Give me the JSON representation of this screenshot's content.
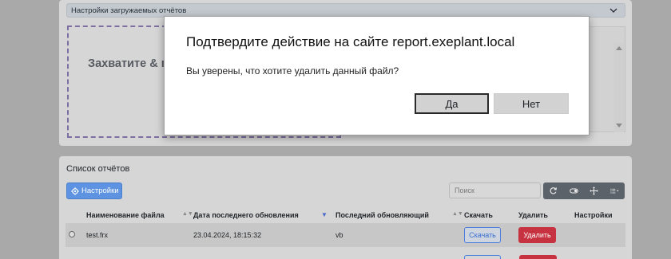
{
  "upload_settings": {
    "accordion_label": "Настройки загружаемых отчётов",
    "dropzone_text": "Захватите & п"
  },
  "reports": {
    "title": "Список отчётов",
    "settings_button": "Настройки",
    "search_placeholder": "Поиск",
    "columns": {
      "name": "Наименование файла",
      "date": "Дата последнего обновления",
      "user": "Последний обновляющий",
      "download": "Скачать",
      "delete": "Удалить",
      "settings": "Настройки"
    },
    "rows": [
      {
        "name": "test.frx",
        "date": "23.04.2024, 18:15:32",
        "user": "vb",
        "download_label": "Скачать",
        "delete_label": "Удалить"
      }
    ]
  },
  "dialog": {
    "title": "Подтвердите действие на сайте report.exeplant.local",
    "message": "Вы уверены, что хотите удалить данный файл?",
    "ok": "Да",
    "cancel": "Нет"
  },
  "colors": {
    "primary": "#5d93e0",
    "danger": "#c6323f",
    "toolbar": "#5c6269"
  },
  "icons": [
    "chevron-down-icon",
    "gear-icon",
    "refresh-icon",
    "toggle-icon",
    "move-icon",
    "list-icon"
  ]
}
